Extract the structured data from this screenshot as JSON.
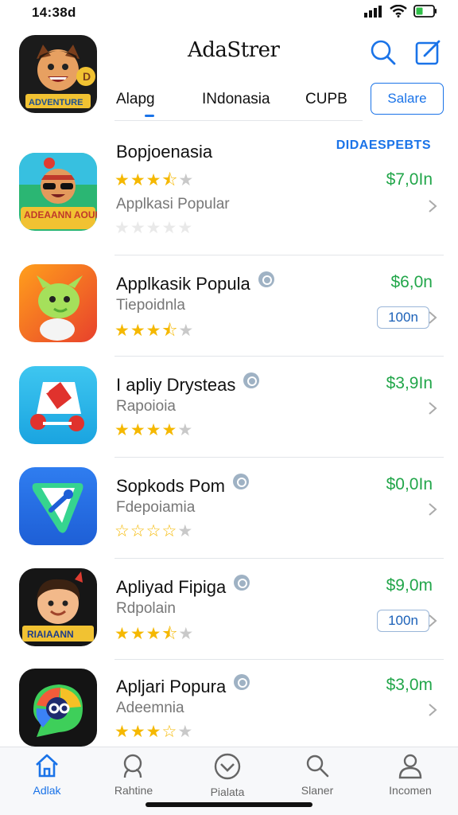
{
  "status_bar": {
    "time": "14:38d"
  },
  "header": {
    "title": "AdaStrer",
    "tabs": [
      "Alapg",
      "INdonasia",
      "CUPB"
    ],
    "filter_label": "Salare"
  },
  "sponsored_label": "DIDAESPEBTS",
  "apps": [
    {
      "title": "Bopjoenasia",
      "verified": false,
      "subtitle": "Applkasi Popular",
      "price": "$7,0In",
      "rating": "3.5",
      "stars": [
        "full",
        "full",
        "full",
        "half",
        "empty"
      ],
      "extra_stars": [
        "empty",
        "empty",
        "empty",
        "empty",
        "empty"
      ],
      "action": "chevron",
      "icon": "adventure-hero-icon",
      "icon_text": "ADEAANN AOUHNAS"
    },
    {
      "title": "Applkasik Popula",
      "verified": true,
      "subtitle": "Tiepoidnla",
      "price": "$6,0n",
      "rating": "3.5",
      "stars": [
        "full",
        "full",
        "full",
        "half",
        "empty"
      ],
      "action": "open",
      "open_label": "100n",
      "icon": "green-creature-icon"
    },
    {
      "title": "I apliy Drysteas",
      "verified": true,
      "subtitle": "Rapoioia",
      "price": "$3,9In",
      "rating": "4",
      "stars": [
        "full",
        "full",
        "full",
        "full",
        "empty"
      ],
      "action": "chevron",
      "icon": "shopping-tags-icon"
    },
    {
      "title": "Sopkods Pom",
      "verified": true,
      "subtitle": "Fdepoiamia",
      "price": "$0,0In",
      "rating": "2",
      "stars": [
        "outline",
        "outline",
        "outline",
        "outline",
        "empty"
      ],
      "action": "chevron",
      "icon": "map-pin-icon"
    },
    {
      "title": "Apliyad Fipiga",
      "verified": true,
      "subtitle": "Rdpolain",
      "price": "$9,0m",
      "rating": "3.5",
      "stars": [
        "full",
        "full",
        "full",
        "half",
        "empty"
      ],
      "action": "open",
      "open_label": "100n",
      "icon": "cartoon-boy-icon",
      "icon_text": "RIAIAANN"
    },
    {
      "title": "Apljari Popura",
      "verified": true,
      "subtitle": "Adeemnia",
      "price": "$3,0m",
      "rating": "3.5",
      "stars": [
        "full",
        "full",
        "full",
        "half",
        "empty"
      ],
      "action": "chevron",
      "icon": "colorful-chat-icon"
    }
  ],
  "bottom_nav": [
    {
      "label": "Adlak",
      "icon": "home-icon",
      "active": true
    },
    {
      "label": "Rahtine",
      "icon": "search-icon",
      "active": false
    },
    {
      "label": "Pialata",
      "icon": "check-circle-icon",
      "active": false
    },
    {
      "label": "Slaner",
      "icon": "magnifier-icon",
      "active": false
    },
    {
      "label": "Incomen",
      "icon": "person-icon",
      "active": false
    }
  ],
  "colors": {
    "accent": "#1a73e8",
    "price": "#22a64a",
    "star": "#f5b800"
  }
}
